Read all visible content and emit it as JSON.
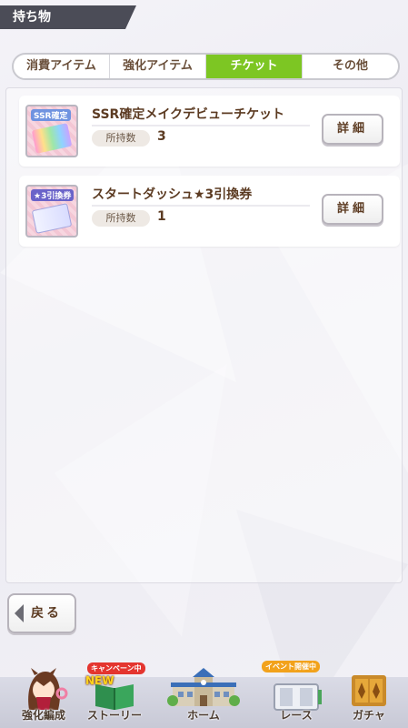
{
  "header": {
    "title": "持ち物"
  },
  "tabs": [
    {
      "label": "消費アイテム",
      "active": false
    },
    {
      "label": "強化アイテム",
      "active": false
    },
    {
      "label": "チケット",
      "active": true
    },
    {
      "label": "その他",
      "active": false
    }
  ],
  "items": [
    {
      "name": "SSR確定メイクデビューチケット",
      "icon": "ssr-ticket-icon",
      "icon_tag": "SSR確定",
      "held_label": "所持数",
      "held_value": "3",
      "detail_label": "詳細"
    },
    {
      "name": "スタートダッシュ★3引換券",
      "icon": "star3-voucher-icon",
      "icon_tag": "★3引換券",
      "held_label": "所持数",
      "held_value": "1",
      "detail_label": "詳細"
    }
  ],
  "back_button": {
    "label": "戻る"
  },
  "nav": [
    {
      "label": "強化編成",
      "icon": "horse-girl-icon"
    },
    {
      "label": "ストーリー",
      "icon": "story-book-icon",
      "badge_top": "キャンペーン中",
      "badge_new": "NEW"
    },
    {
      "label": "ホーム",
      "icon": "school-building-icon"
    },
    {
      "label": "レース",
      "icon": "race-track-icon",
      "badge_top": "イベント開催中"
    },
    {
      "label": "ガチャ",
      "icon": "gacha-door-icon"
    }
  ],
  "colors": {
    "tab_active": "#7dc623",
    "text_brown": "#5c3b22",
    "header_bg": "#4b4c57"
  }
}
